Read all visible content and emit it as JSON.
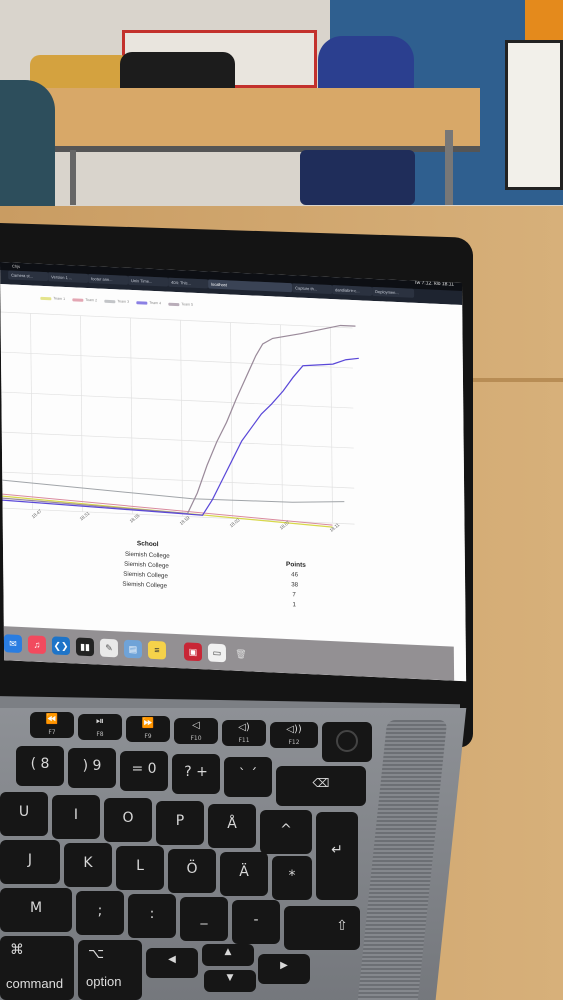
{
  "browser": {
    "tabs": [
      {
        "label": "Camera st..."
      },
      {
        "label": "Version 1 ..."
      },
      {
        "label": "footer ann..."
      },
      {
        "label": "Unix Time..."
      },
      {
        "label": "404: This..."
      },
      {
        "label": "localhost"
      },
      {
        "label": "Capture th..."
      },
      {
        "label": "dandiabre-c..."
      },
      {
        "label": "Deploymen..."
      }
    ],
    "menu": "Chjs",
    "clock": "Iw 7.12. klo 18.11"
  },
  "chart_data": {
    "type": "line",
    "legend": [
      "Team 1",
      "Team 2",
      "Team 3",
      "Team 4",
      "Team 5"
    ],
    "x_ticks": [
      "18.47",
      "18.51",
      "18.55",
      "18.59",
      "18.03",
      "18.07",
      "18.11"
    ],
    "series": [
      {
        "name": "Team 1",
        "color": "#d8d84a"
      },
      {
        "name": "Team 2",
        "color": "#d98a9e"
      },
      {
        "name": "Team 3",
        "color": "#a0a4a8"
      },
      {
        "name": "Team 4",
        "color": "#5a48d8"
      },
      {
        "name": "Team 5",
        "color": "#9a8a9a"
      }
    ]
  },
  "results": {
    "header_school": "School",
    "header_points": "Points",
    "rows": [
      {
        "school": "Siemish College",
        "points": "46"
      },
      {
        "school": "Siemish College",
        "points": "38"
      },
      {
        "school": "Siemish College",
        "points": "7"
      },
      {
        "school": "Siemish College",
        "points": "1"
      }
    ]
  },
  "keyboard": {
    "fn_row": [
      {
        "main": "⏪",
        "sub": "F7"
      },
      {
        "main": "⏯",
        "sub": "F8"
      },
      {
        "main": "⏩",
        "sub": "F9"
      },
      {
        "main": "◁",
        "sub": "F10"
      },
      {
        "main": "◁)",
        "sub": "F11"
      },
      {
        "main": "◁))",
        "sub": "F12"
      }
    ],
    "num_row": [
      {
        "main": "( 8"
      },
      {
        "main": ") 9"
      },
      {
        "main": "= 0"
      },
      {
        "main": "? +"
      },
      {
        "main": "` ´"
      }
    ],
    "letters_row1": [
      "U",
      "I",
      "O",
      "P",
      "Å"
    ],
    "letters_row2": [
      "J",
      "K",
      "L",
      "Ö",
      "Ä"
    ],
    "letters_row3": [
      "M",
      ";",
      ":",
      "_",
      "-"
    ],
    "command_label": "command",
    "option_label": "option",
    "command_symbol": "⌘",
    "option_symbol": "⌥"
  }
}
